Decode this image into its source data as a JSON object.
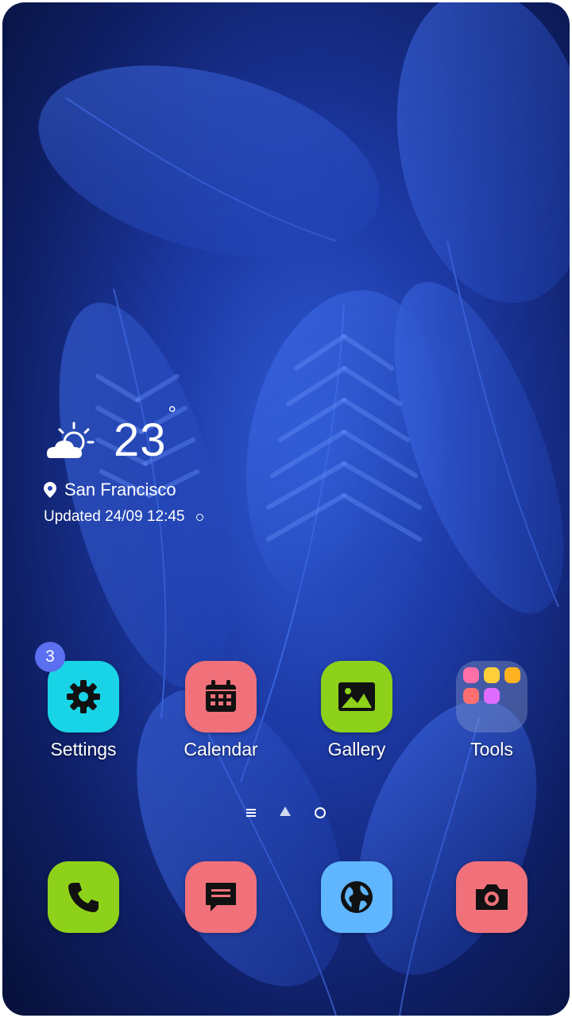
{
  "weather": {
    "temperature": "23",
    "degree_symbol": "°",
    "location": "San Francisco",
    "updated": "Updated 24/09 12:45",
    "icon": "partly-cloudy-icon"
  },
  "apps": [
    {
      "label": "Settings",
      "icon": "gear-icon",
      "color": "#19d4e6",
      "badge": "3"
    },
    {
      "label": "Calendar",
      "icon": "calendar-icon",
      "color": "#f0717a"
    },
    {
      "label": "Gallery",
      "icon": "gallery-icon",
      "color": "#8ed11a"
    },
    {
      "label": "Tools",
      "icon": "folder-icon"
    }
  ],
  "dock": [
    {
      "icon": "phone-icon",
      "color": "#8ed11a"
    },
    {
      "icon": "message-icon",
      "color": "#f0717a"
    },
    {
      "icon": "globe-icon",
      "color": "#5fb6ff"
    },
    {
      "icon": "camera-icon",
      "color": "#f0717a"
    }
  ],
  "colors": {
    "wallpaper_primary": "#2f5bd6",
    "wallpaper_dark": "#071038",
    "badge": "#5b6ff0"
  }
}
